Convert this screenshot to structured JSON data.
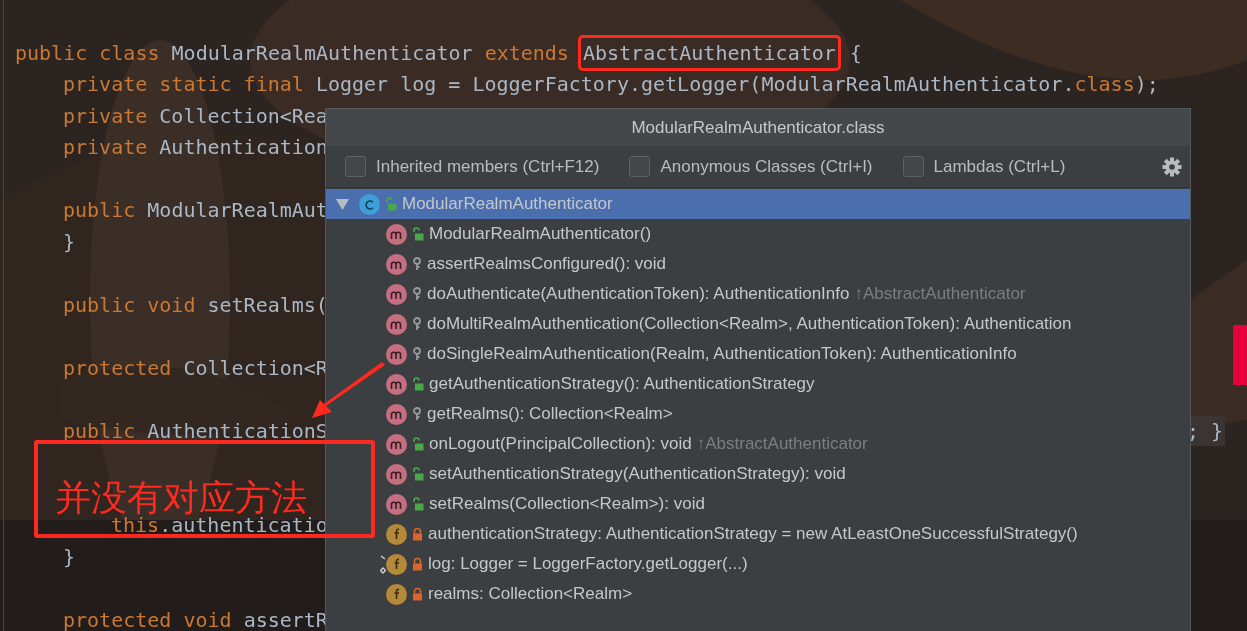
{
  "editor": {
    "lines": [
      {
        "kind": "top",
        "tokens": [
          {
            "text": "public class ",
            "kind": "keyword"
          },
          {
            "text": "ModularRealmAuthenticator ",
            "kind": "plain"
          },
          {
            "text": "extends ",
            "kind": "keyword"
          },
          {
            "text": "AbstractAuthenticator",
            "kind": "plain",
            "highlighted": true
          },
          {
            "text": " {",
            "kind": "plain"
          }
        ]
      },
      {
        "kind": "member",
        "tokens": [
          {
            "text": "private static final ",
            "kind": "keyword"
          },
          {
            "text": "Logger log = LoggerFactory.getLogger(ModularRealmAuthenticator.",
            "kind": "plain"
          },
          {
            "text": "class",
            "kind": "keyword"
          },
          {
            "text": ");",
            "kind": "plain"
          }
        ]
      },
      {
        "kind": "member",
        "tokens": [
          {
            "text": "private ",
            "kind": "keyword"
          },
          {
            "text": "Collection<Rea",
            "kind": "plain"
          }
        ]
      },
      {
        "kind": "member",
        "tokens": [
          {
            "text": "private ",
            "kind": "keyword"
          },
          {
            "text": "Authentication",
            "kind": "plain"
          }
        ]
      },
      {
        "kind": "blank"
      },
      {
        "kind": "member",
        "tokens": [
          {
            "text": "public ",
            "kind": "keyword"
          },
          {
            "text": "ModularRealmAut",
            "kind": "plain"
          }
        ]
      },
      {
        "kind": "member",
        "tokens": [
          {
            "text": "}",
            "kind": "plain"
          }
        ]
      },
      {
        "kind": "blank"
      },
      {
        "kind": "member",
        "tokens": [
          {
            "text": "public void ",
            "kind": "keyword"
          },
          {
            "text": "setRealms(",
            "kind": "plain"
          }
        ]
      },
      {
        "kind": "blank"
      },
      {
        "kind": "member",
        "tokens": [
          {
            "text": "protected ",
            "kind": "keyword"
          },
          {
            "text": "Collection<R",
            "kind": "plain"
          }
        ]
      },
      {
        "kind": "blank"
      },
      {
        "kind": "member",
        "tokens": [
          {
            "text": "public ",
            "kind": "keyword"
          },
          {
            "text": "AuthenticationS",
            "kind": "plain"
          }
        ],
        "tail": "; }"
      },
      {
        "kind": "blank"
      },
      {
        "kind": "blank"
      },
      {
        "kind": "body",
        "tokens": [
          {
            "text": "this",
            "kind": "keyword"
          },
          {
            "text": ".authenticatio",
            "kind": "plain"
          }
        ]
      },
      {
        "kind": "member",
        "tokens": [
          {
            "text": "}",
            "kind": "plain"
          }
        ]
      },
      {
        "kind": "blank"
      },
      {
        "kind": "member",
        "tokens": [
          {
            "text": "protected void ",
            "kind": "keyword"
          },
          {
            "text": "assertR",
            "kind": "plain"
          }
        ]
      }
    ]
  },
  "annotation": {
    "text": "并没有对应方法"
  },
  "popup": {
    "title": "ModularRealmAuthenticator.class",
    "options": [
      {
        "label": "Inherited members (Ctrl+F12)",
        "checked": false
      },
      {
        "label": "Anonymous Classes (Ctrl+I)",
        "checked": false
      },
      {
        "label": "Lambdas (Ctrl+L)",
        "checked": false
      }
    ],
    "tree": [
      {
        "kind": "class",
        "access": {
          "kind": "public"
        },
        "label": "ModularRealmAuthenticator",
        "selected": true,
        "expanded": true,
        "children": [
          {
            "kind": "method",
            "access": {
              "kind": "public"
            },
            "label": "ModularRealmAuthenticator()",
            "selected": false
          },
          {
            "kind": "method",
            "access": {
              "kind": "protected"
            },
            "label": "assertRealmsConfigured(): void",
            "selected": false
          },
          {
            "kind": "method",
            "access": {
              "kind": "protected"
            },
            "label": "doAuthenticate(AuthenticationToken): AuthenticationInfo",
            "inherited": "↑AbstractAuthenticator",
            "selected": false
          },
          {
            "kind": "method",
            "access": {
              "kind": "protected"
            },
            "label": "doMultiRealmAuthentication(Collection<Realm>, AuthenticationToken): Authentication",
            "selected": false
          },
          {
            "kind": "method",
            "access": {
              "kind": "protected"
            },
            "label": "doSingleRealmAuthentication(Realm, AuthenticationToken): AuthenticationInfo",
            "selected": false
          },
          {
            "kind": "method",
            "access": {
              "kind": "public"
            },
            "label": "getAuthenticationStrategy(): AuthenticationStrategy",
            "selected": false
          },
          {
            "kind": "method",
            "access": {
              "kind": "protected"
            },
            "label": "getRealms(): Collection<Realm>",
            "selected": false
          },
          {
            "kind": "method",
            "access": {
              "kind": "public"
            },
            "label": "onLogout(PrincipalCollection): void",
            "inherited": "↑AbstractAuthenticator",
            "selected": false
          },
          {
            "kind": "method",
            "access": {
              "kind": "public"
            },
            "label": "setAuthenticationStrategy(AuthenticationStrategy): void",
            "selected": false
          },
          {
            "kind": "method",
            "access": {
              "kind": "public"
            },
            "label": "setRealms(Collection<Realm>): void",
            "selected": false
          },
          {
            "kind": "field",
            "access": {
              "kind": "private"
            },
            "label": "authenticationStrategy: AuthenticationStrategy = new AtLeastOneSuccessfulStrategy()",
            "selected": false
          },
          {
            "kind": "field",
            "access": {
              "kind": "private"
            },
            "static": true,
            "label": "log: Logger = LoggerFactory.getLogger(...)",
            "selected": false
          },
          {
            "kind": "field",
            "access": {
              "kind": "private"
            },
            "label": "realms: Collection<Realm>",
            "selected": false
          }
        ]
      }
    ]
  }
}
